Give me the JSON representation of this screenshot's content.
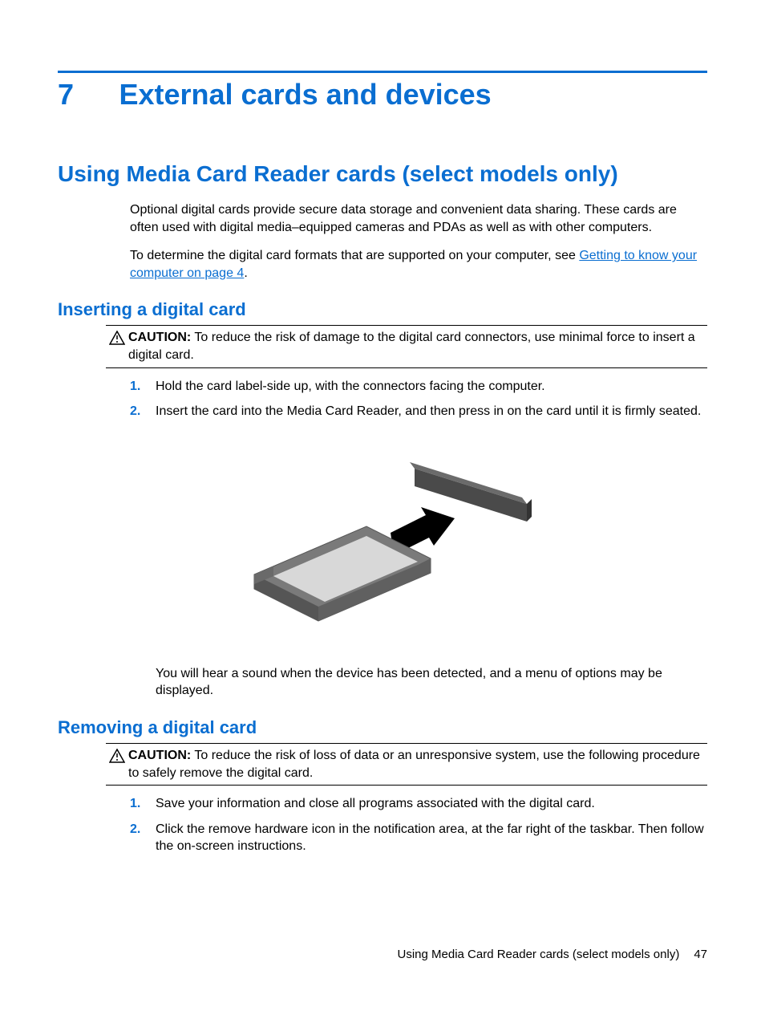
{
  "chapter": {
    "number": "7",
    "title": "External cards and devices"
  },
  "h1": "Using Media Card Reader cards (select models only)",
  "intro": {
    "p1": "Optional digital cards provide secure data storage and convenient data sharing. These cards are often used with digital media–equipped cameras and PDAs as well as with other computers.",
    "p2a": "To determine the digital card formats that are supported on your computer, see ",
    "link": "Getting to know your computer on page 4",
    "p2b": "."
  },
  "section_insert": {
    "title": "Inserting a digital card",
    "caution_label": "CAUTION:",
    "caution_text": "   To reduce the risk of damage to the digital card connectors, use minimal force to insert a digital card.",
    "steps": [
      "Hold the card label-side up, with the connectors facing the computer.",
      "Insert the card into the Media Card Reader, and then press in on the card until it is firmly seated."
    ],
    "after": "You will hear a sound when the device has been detected, and a menu of options may be displayed."
  },
  "section_remove": {
    "title": "Removing a digital card",
    "caution_label": "CAUTION:",
    "caution_text": "   To reduce the risk of loss of data or an unresponsive system, use the following procedure to safely remove the digital card.",
    "steps": [
      "Save your information and close all programs associated with the digital card.",
      "Click the remove hardware icon in the notification area, at the far right of the taskbar. Then follow the on-screen instructions."
    ]
  },
  "numbers": {
    "n1": "1.",
    "n2": "2."
  },
  "footer": {
    "section": "Using Media Card Reader cards (select models only)",
    "page": "47"
  }
}
